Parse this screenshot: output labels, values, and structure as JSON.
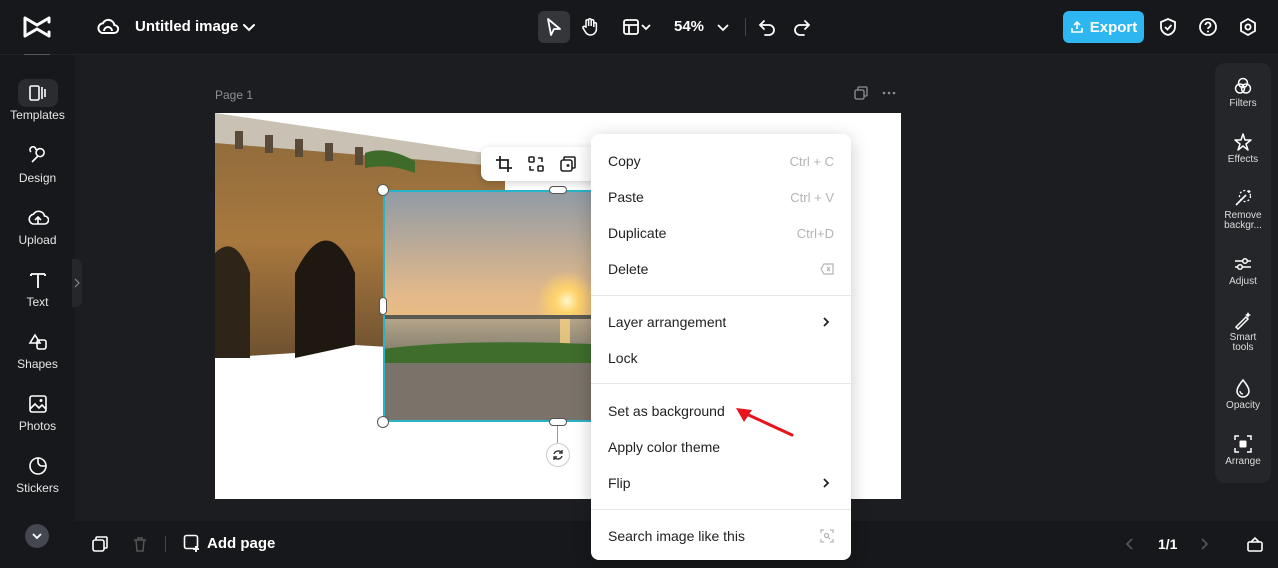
{
  "header": {
    "title": "Untitled image",
    "zoom": "54%",
    "export_label": "Export"
  },
  "sidebar": {
    "items": [
      {
        "label": "Templates",
        "icon": "templates-icon"
      },
      {
        "label": "Design",
        "icon": "design-icon"
      },
      {
        "label": "Upload",
        "icon": "upload-icon"
      },
      {
        "label": "Text",
        "icon": "text-icon"
      },
      {
        "label": "Shapes",
        "icon": "shapes-icon"
      },
      {
        "label": "Photos",
        "icon": "photos-icon"
      },
      {
        "label": "Stickers",
        "icon": "stickers-icon"
      }
    ]
  },
  "canvas": {
    "page_label": "Page 1"
  },
  "right_panel": {
    "items": [
      {
        "label": "Filters"
      },
      {
        "label": "Effects"
      },
      {
        "label": "Remove backgr..."
      },
      {
        "label": "Adjust"
      },
      {
        "label": "Smart tools"
      },
      {
        "label": "Opacity"
      },
      {
        "label": "Arrange"
      }
    ]
  },
  "context_menu": {
    "items": [
      {
        "label": "Copy",
        "shortcut": "Ctrl + C"
      },
      {
        "label": "Paste",
        "shortcut": "Ctrl + V"
      },
      {
        "label": "Duplicate",
        "shortcut": "Ctrl+D"
      },
      {
        "label": "Delete",
        "shortcut": ""
      },
      {
        "label": "Layer arrangement",
        "shortcut": ""
      },
      {
        "label": "Lock",
        "shortcut": ""
      },
      {
        "label": "Set as background",
        "shortcut": ""
      },
      {
        "label": "Apply color theme",
        "shortcut": ""
      },
      {
        "label": "Flip",
        "shortcut": ""
      },
      {
        "label": "Search image like this",
        "shortcut": ""
      }
    ]
  },
  "bottom": {
    "add_page": "Add page",
    "page_count": "1/1"
  },
  "colors": {
    "accent": "#2eb6f0",
    "selection": "#28b4c8",
    "arrow": "#e8141c"
  }
}
